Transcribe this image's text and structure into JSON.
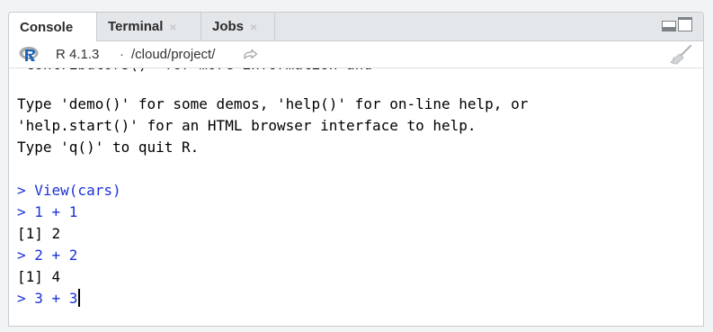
{
  "tabs": [
    {
      "label": "Console",
      "active": true,
      "closable": false
    },
    {
      "label": "Terminal",
      "active": false,
      "closable": true
    },
    {
      "label": "Jobs",
      "active": false,
      "closable": true
    }
  ],
  "close_glyph": "×",
  "subbar": {
    "r_version": "R 4.1.3",
    "separator": "·",
    "working_dir": "/cloud/project/",
    "icons": [
      "r-logo-icon",
      "goto-directory-icon",
      "clear-console-broom-icon"
    ]
  },
  "console": {
    "clipped_line": "'contributors()' for more information and",
    "lines": [
      {
        "kind": "output",
        "text": "Type 'demo()' for some demos, 'help()' for on-line help, or"
      },
      {
        "kind": "output",
        "text": "'help.start()' for an HTML browser interface to help."
      },
      {
        "kind": "output",
        "text": "Type 'q()' to quit R."
      },
      {
        "kind": "blank",
        "text": ""
      },
      {
        "kind": "input",
        "text": "> View(cars)"
      },
      {
        "kind": "input",
        "text": "> 1 + 1"
      },
      {
        "kind": "output",
        "text": "[1] 2"
      },
      {
        "kind": "input",
        "text": "> 2 + 2"
      },
      {
        "kind": "output",
        "text": "[1] 4"
      },
      {
        "kind": "input",
        "text": "> 3 + 3"
      }
    ]
  },
  "colors": {
    "input_text": "#1a32d6",
    "output_text": "#000000",
    "tabbar_bg": "#e4e7ea",
    "r_logo_blue": "#2165b6",
    "r_logo_grey": "#a6a9ad"
  }
}
